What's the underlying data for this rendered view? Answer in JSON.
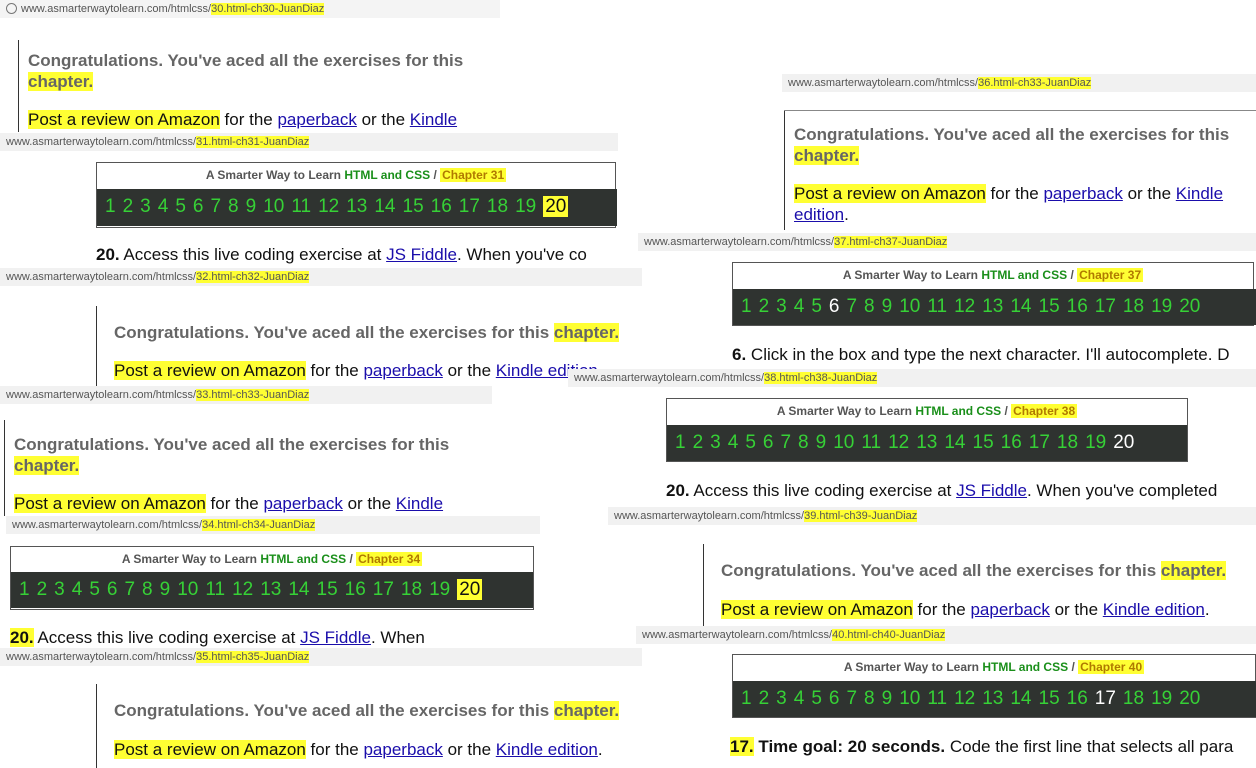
{
  "urls": {
    "u30": {
      "base": "www.asmarterwaytolearn.com/htmlcss/",
      "path": "30.html-ch30-JuanDiaz"
    },
    "u31": {
      "base": "www.asmarterwaytolearn.com/htmlcss/",
      "path": "31.html-ch31-JuanDiaz"
    },
    "u32": {
      "base": "www.asmarterwaytolearn.com/htmlcss/",
      "path": "32.html-ch32-JuanDiaz"
    },
    "u33": {
      "base": "www.asmarterwaytolearn.com/htmlcss/",
      "path": "33.html-ch33-JuanDiaz"
    },
    "u34": {
      "base": "www.asmarterwaytolearn.com/htmlcss/",
      "path": "34.html-ch34-JuanDiaz"
    },
    "u35": {
      "base": "www.asmarterwaytolearn.com/htmlcss/",
      "path": "35.html-ch35-JuanDiaz"
    },
    "u36": {
      "base": "www.asmarterwaytolearn.com/htmlcss/",
      "path": "36.html-ch33-JuanDiaz"
    },
    "u37": {
      "base": "www.asmarterwaytolearn.com/htmlcss/",
      "path": "37.html-ch37-JuanDiaz"
    },
    "u38": {
      "base": "www.asmarterwaytolearn.com/htmlcss/",
      "path": "38.html-ch38-JuanDiaz"
    },
    "u39": {
      "base": "www.asmarterwaytolearn.com/htmlcss/",
      "path": "39.html-ch39-JuanDiaz"
    },
    "u40": {
      "base": "www.asmarterwaytolearn.com/htmlcss/",
      "path": "40.html-ch40-JuanDiaz"
    }
  },
  "congrats": {
    "full": "Congratulations. You've aced all the exercises for this",
    "word": "chapter."
  },
  "review": {
    "post": "Post a review on Amazon",
    "for_the": " for the ",
    "paperback": "paperback",
    "or_the": " or the ",
    "kindle": "Kindle",
    "edition": "edition",
    "kindle_edition": "Kindle edition",
    "period": "."
  },
  "panel": {
    "title_prefix": "A Smarter Way to Learn ",
    "title_green": "HTML and CSS",
    "sep": " / ",
    "ch31": "Chapter 31",
    "ch34": "Chapter 34",
    "ch37": "Chapter 37",
    "ch38": "Chapter 38",
    "ch40": "Chapter 40"
  },
  "numbers": [
    "1",
    "2",
    "3",
    "4",
    "5",
    "6",
    "7",
    "8",
    "9",
    "10",
    "11",
    "12",
    "13",
    "14",
    "15",
    "16",
    "17",
    "18",
    "19",
    "20"
  ],
  "instr": {
    "i31_num": "20.",
    "i31_text": " Access this live coding exercise at ",
    "jsfiddle": "JS Fiddle",
    "i31_tail": ". When you've co",
    "i34_tail": ". When",
    "i37_num": "6.",
    "i37_text": " Click in the box and type the next character. I'll autocomplete. D",
    "i38_tail": ". When you've completed",
    "i40_num": "17.",
    "i40_bold": " Time goal: 20 seconds.",
    "i40_text": " Code the first line that selects all para"
  },
  "colors": {
    "highlight": "#ffff33",
    "bar_bg": "#2f3330",
    "bar_num": "#36d136",
    "link": "#1a0dab",
    "green_title": "#1a8f1a"
  }
}
